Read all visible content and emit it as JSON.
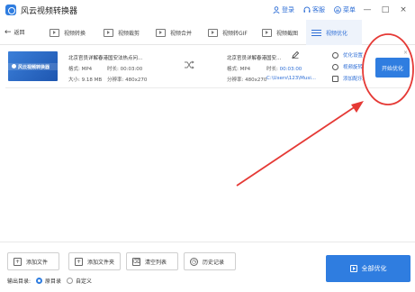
{
  "app": {
    "title": "风云视频转换器"
  },
  "titlebar": {
    "login": "登录",
    "service": "客服",
    "menu": "菜单",
    "minimize": "—",
    "maximize": "□",
    "close": "×"
  },
  "toolbar": {
    "back": "返回",
    "tools": [
      {
        "label": "视频转换"
      },
      {
        "label": "视频裁剪"
      },
      {
        "label": "视频合并"
      },
      {
        "label": "视频转GIF"
      },
      {
        "label": "视频截图"
      },
      {
        "label": "视频优化"
      }
    ]
  },
  "file": {
    "thumb_text": "风云视频转换器",
    "source": {
      "title": "北京官员详解春港国安法热点问...",
      "format": "格式: MP4",
      "duration": "时长: 00:03:00",
      "size": "大小: 9.18 MB",
      "resolution": "分辨率: 480x270"
    },
    "output": {
      "title": "北京官员详解春港国安...",
      "format": "格式: MP4",
      "duration_label": "时长:",
      "duration_value": "00:03:00",
      "resolution": "分辨率: 480x270",
      "path": "C:\\Users\\123\\Musi..."
    },
    "options": {
      "optimize_settings": "优化设置",
      "video_rotate": "视频旋转",
      "add_subtitle": "添加配乐"
    },
    "start_button": "开始优化",
    "remove": "×"
  },
  "bottom": {
    "add_file": "添加文件",
    "add_folder": "添加文件夹",
    "clear_list": "清空列表",
    "history": "历史记录",
    "output_dir_label": "输出目录:",
    "option_original": "原目录",
    "option_custom": "自定义",
    "all_optimize": "全部优化"
  },
  "colors": {
    "accent": "#2f7de0",
    "annotation": "#e53935"
  }
}
